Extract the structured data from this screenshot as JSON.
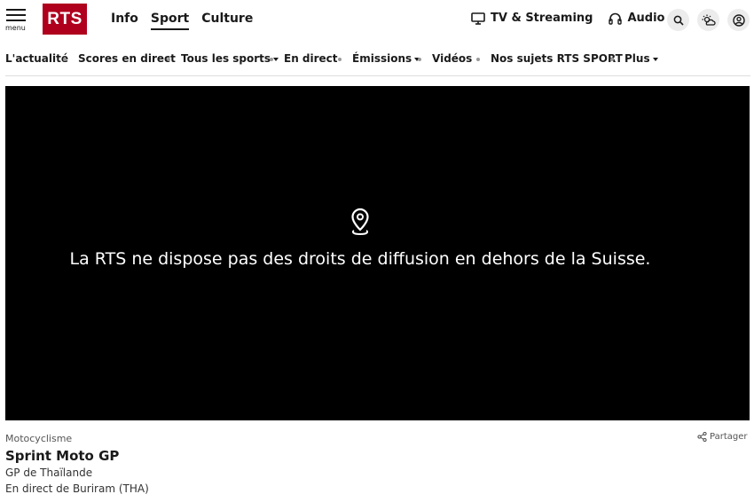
{
  "header": {
    "menu_label": "menu",
    "logo_text": "RTS",
    "logo_color": "#af001e",
    "main_nav": [
      {
        "label": "Info",
        "active": false
      },
      {
        "label": "Sport",
        "active": true
      },
      {
        "label": "Culture",
        "active": false
      }
    ],
    "right_nav": [
      {
        "label": "TV & Streaming",
        "icon": "tv-icon"
      },
      {
        "label": "Audio",
        "icon": "headphones-icon"
      }
    ],
    "icons": [
      "search-icon",
      "weather-icon",
      "account-icon"
    ]
  },
  "subnav": {
    "items": [
      {
        "label": "L'actualité",
        "dropdown": false
      },
      {
        "label": "Scores en direct",
        "dropdown": false
      },
      {
        "label": "Tous les sports",
        "dropdown": true
      },
      {
        "label": "En direct",
        "dropdown": false
      },
      {
        "label": "Émissions",
        "dropdown": true
      },
      {
        "label": "Vidéos",
        "dropdown": false
      },
      {
        "label": "Nos sujets RTS SPORT",
        "dropdown": false
      },
      {
        "label": "Plus",
        "dropdown": true
      }
    ]
  },
  "player": {
    "icon": "location-pin-icon",
    "message": "La RTS ne dispose pas des droits de diffusion en dehors de la Suisse."
  },
  "meta": {
    "category": "Motocyclisme",
    "share_label": "Partager",
    "title": "Sprint Moto GP",
    "subtitle": "GP de Thaïlande",
    "location": "En direct de Buriram (THA)"
  }
}
